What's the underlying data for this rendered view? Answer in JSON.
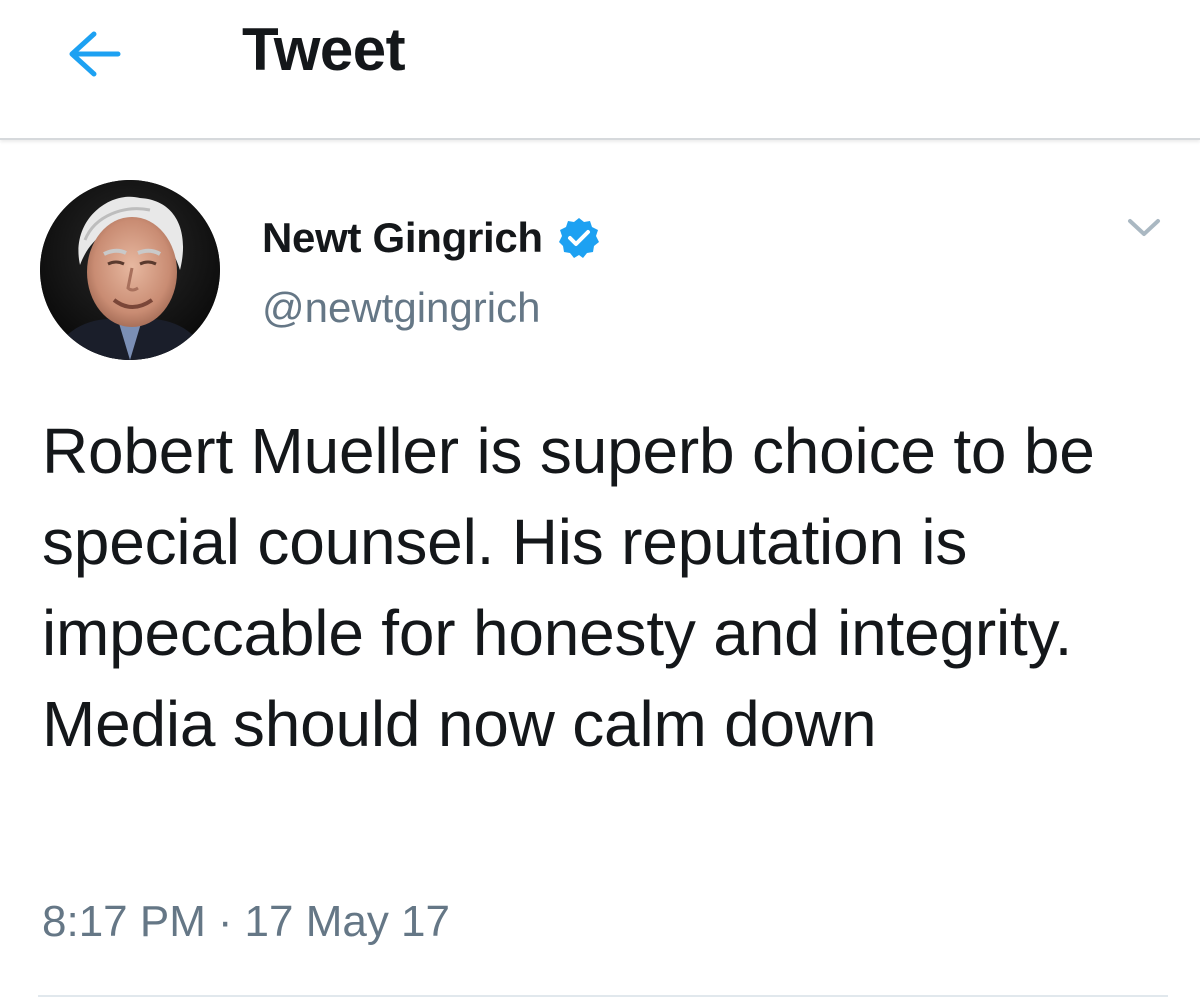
{
  "header": {
    "back_icon": "arrow-left-icon",
    "title": "Tweet",
    "accent_color": "#1da1f2"
  },
  "tweet": {
    "author": {
      "name": "Newt Gingrich",
      "handle": "@newtgingrich",
      "verified": true,
      "verified_icon": "verified-badge-icon",
      "verified_color": "#1da1f2"
    },
    "menu_icon": "chevron-down-icon",
    "text": "Robert Mueller is superb choice to be special counsel. His reputation is impeccable for honesty and integrity. Media should now calm down",
    "time": "8:17 PM",
    "separator": "·",
    "date": "17 May 17"
  }
}
